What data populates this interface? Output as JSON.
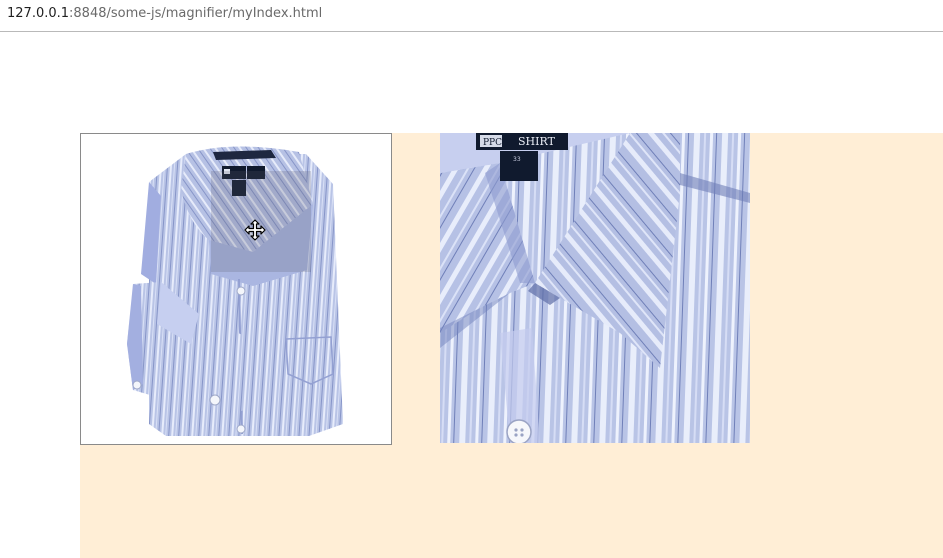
{
  "browser": {
    "url_host": "127.0.0.1",
    "url_rest": ":8848/some-js/magnifier/myIndex.html"
  },
  "product": {
    "label_brand": "PPC",
    "label_text": "SHIRT",
    "size_text": "33",
    "colors": {
      "page_bg": "#ffffff",
      "stage_bg": "#ffeed6",
      "shirt_base": "#b9c4e6",
      "shirt_stripe": "#e7ecfb",
      "shirt_dark_stripe": "#6f7fb8",
      "label": "#101a2e"
    }
  },
  "icons": {
    "cursor": "move-cursor-icon"
  }
}
